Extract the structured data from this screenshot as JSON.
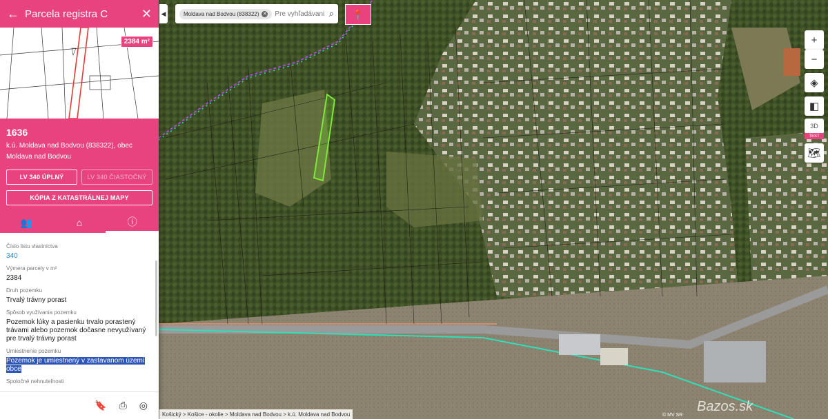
{
  "panel": {
    "title": "Parcela registra C",
    "area_badge": "2384 m²",
    "parcel_number": "1636",
    "parcel_desc": "k.ú. Moldava nad Bodvou (838322), obec Moldava nad Bodvou",
    "btn_lv_full": "LV 340 ÚPLNÝ",
    "btn_lv_partial": "LV 340 ČIASTOČNÝ",
    "btn_copy": "KÓPIA Z KATASTRÁLNEJ MAPY",
    "tabs": [
      "owners-icon",
      "building-icon",
      "info-icon"
    ],
    "fields": [
      {
        "label": "Číslo listu vlastníctva",
        "value": "340"
      },
      {
        "label": "Výmera parcely v m²",
        "value": "2384"
      },
      {
        "label": "Druh pozemku",
        "value": "Trvalý trávny porast"
      },
      {
        "label": "Spôsob využívania pozemku",
        "value": "Pozemok lúky a pasienku trvalo porastený trávami alebo pozemok dočasne nevyužívaný pre trvalý trávny porast"
      },
      {
        "label": "Umiestnenie pozemku",
        "value": "Pozemok je umiestnený v zastavanom území obce"
      },
      {
        "label": "Spoločné nehnuteľnosti",
        "value": ""
      }
    ],
    "footer_icons": [
      "bookmark-icon",
      "print-icon",
      "locate-icon"
    ]
  },
  "search": {
    "chip": "Moldava nad Bodvou (838322)",
    "placeholder": "Pre vyhľadávani"
  },
  "toolbar": {
    "zoom_in": "+",
    "zoom_out": "−",
    "three_d": "3D",
    "test_badge": "TEST"
  },
  "breadcrumb": "Košický > Košice - okolie > Moldava nad Bodvou > k.ú. Moldava nad Bodvou",
  "copyright": "© MV SR",
  "watermark": "Bazos.sk",
  "colors": {
    "accent": "#e8437f",
    "parcel_highlight": "#7fe83a",
    "road_line": "#2ee0b8",
    "boundary": "#a64bd6"
  }
}
